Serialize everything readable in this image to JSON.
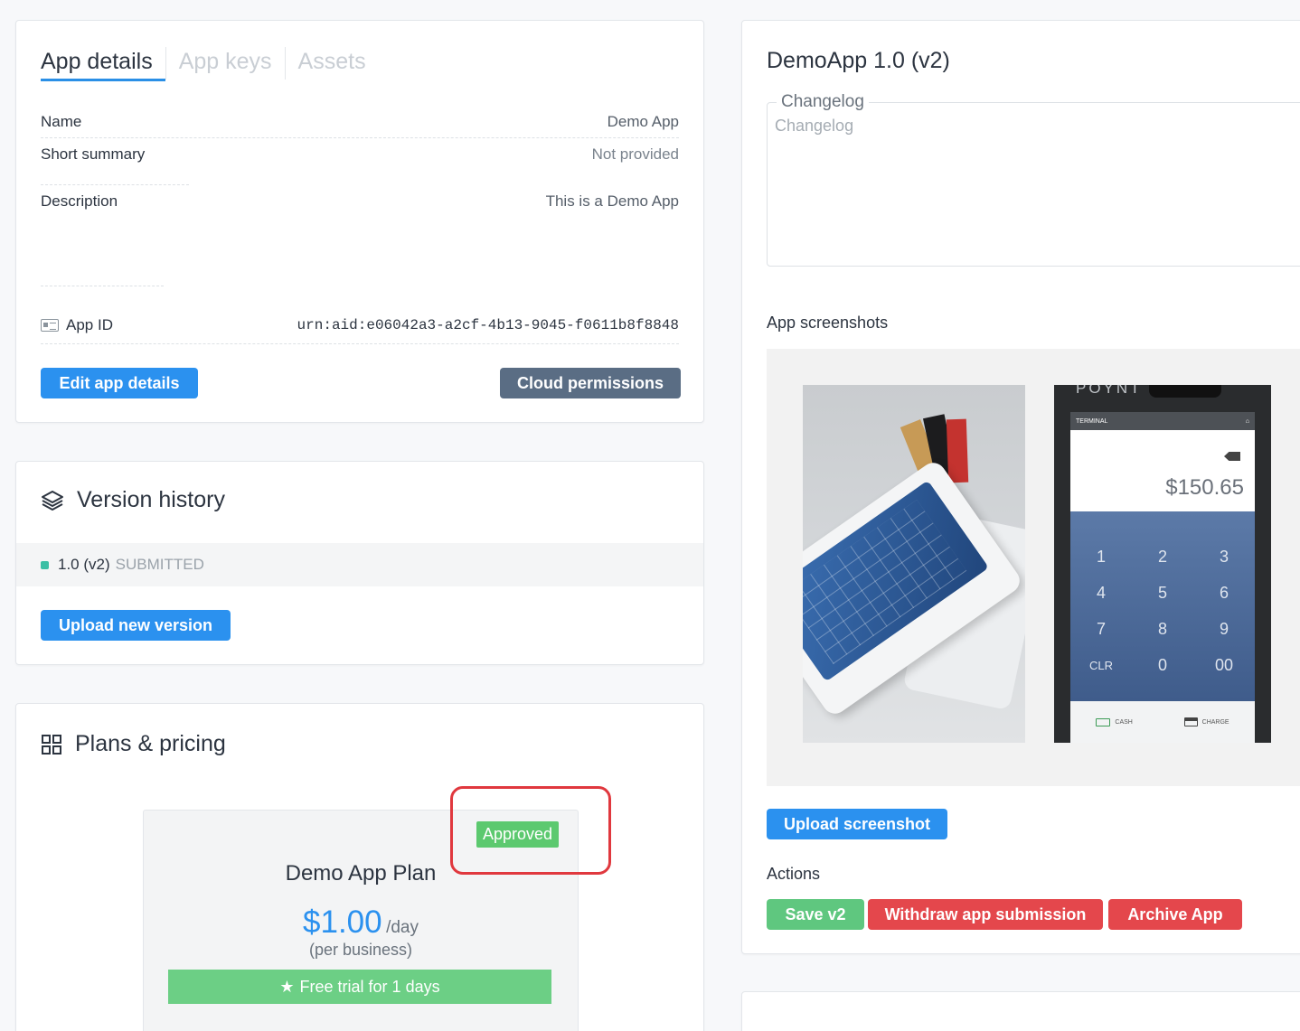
{
  "details": {
    "tabs": [
      {
        "label": "App details",
        "active": true
      },
      {
        "label": "App keys",
        "active": false
      },
      {
        "label": "Assets",
        "active": false
      }
    ],
    "name_label": "Name",
    "name_value": "Demo App",
    "summary_label": "Short summary",
    "summary_value": "Not provided",
    "description_label": "Description",
    "description_value": "This is a Demo App",
    "appid_label": "App ID",
    "appid_value": "urn:aid:e06042a3-a2cf-4b13-9045-f0611b8f8848",
    "edit_button": "Edit app details",
    "cloud_button": "Cloud permissions"
  },
  "version_history": {
    "title": "Version history",
    "version": "1.0 (v2)",
    "status": "SUBMITTED",
    "upload_button": "Upload new version"
  },
  "plans": {
    "title": "Plans & pricing",
    "plan_status": "Approved",
    "plan_name": "Demo App Plan",
    "price": "$1.00",
    "period": "/day",
    "basis": "(per business)",
    "trial": "Free trial for 1 days"
  },
  "right": {
    "title": "DemoApp 1.0 (v2)",
    "changelog_legend": "Changelog",
    "changelog_placeholder": "Changelog",
    "screenshots_label": "App screenshots",
    "upload_screenshot": "Upload screenshot",
    "actions_label": "Actions",
    "save_button": "Save v2",
    "withdraw_button": "Withdraw app submission",
    "archive_button": "Archive App"
  },
  "device": {
    "brand": "POYNT",
    "status_text": "TERMINAL",
    "amount": "$150.65",
    "keys": [
      "1",
      "2",
      "3",
      "4",
      "5",
      "6",
      "7",
      "8",
      "9",
      "CLR",
      "0",
      "00"
    ],
    "cash_label": "CASH",
    "charge_label": "CHARGE"
  },
  "colors": {
    "primary": "#2b91ef",
    "slate": "#5a6d84",
    "success": "#5fc77f",
    "danger": "#e4474c",
    "highlight": "#e0383e"
  }
}
